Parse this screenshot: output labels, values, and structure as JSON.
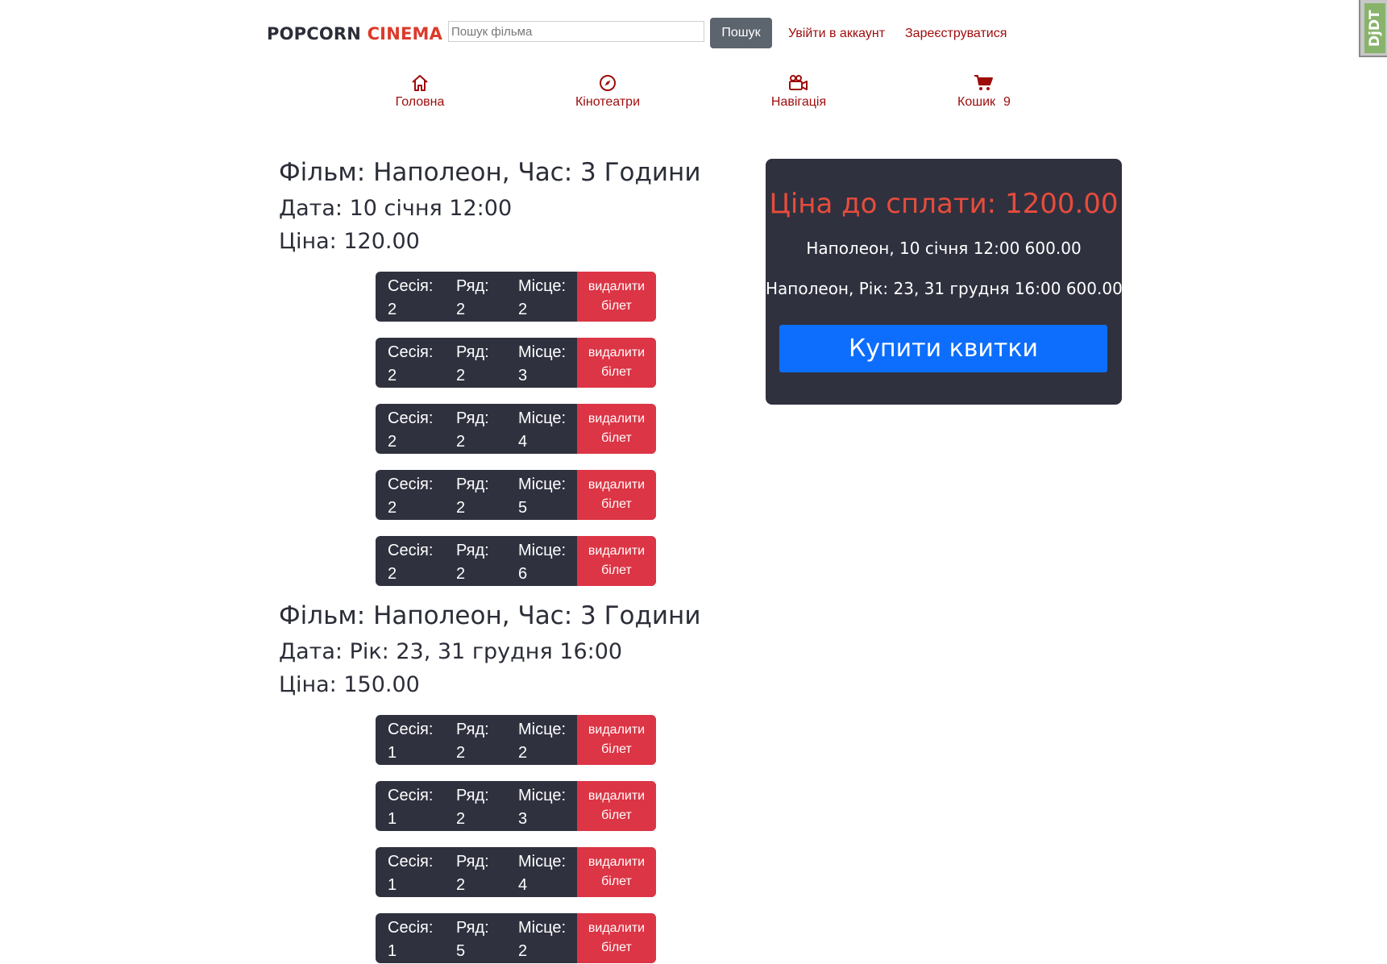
{
  "header": {
    "logo_part1": "POPCORN",
    "logo_part2": "CINEMA",
    "search_placeholder": "Пошук фільма",
    "search_button": "Пошук",
    "login": "Увійти в аккаунт",
    "register": "Зареєструватися"
  },
  "nav": {
    "home": {
      "label": "Головна",
      "icon": "home-icon"
    },
    "cinemas": {
      "label": "Кінотеатри",
      "icon": "compass-icon"
    },
    "navigation": {
      "label": "Навігація",
      "icon": "video-camera-icon"
    },
    "cart": {
      "label": "Кошик",
      "count": "9",
      "icon": "cart-icon"
    }
  },
  "labels": {
    "session": "Сесія:",
    "row": "Ряд:",
    "seat": "Місце:",
    "remove": "видалити білет"
  },
  "groups": [
    {
      "film": "Фільм: Наполеон, Час: 3 Години",
      "date": "Дата: 10 січня 12:00",
      "price": "Ціна: 120.00",
      "tickets": [
        {
          "session": "2",
          "row": "2",
          "seat": "2"
        },
        {
          "session": "2",
          "row": "2",
          "seat": "3"
        },
        {
          "session": "2",
          "row": "2",
          "seat": "4"
        },
        {
          "session": "2",
          "row": "2",
          "seat": "5"
        },
        {
          "session": "2",
          "row": "2",
          "seat": "6"
        }
      ]
    },
    {
      "film": "Фільм: Наполеон, Час: 3 Години",
      "date": "Дата: Рік: 23, 31 грудня 16:00",
      "price": "Ціна: 150.00",
      "tickets": [
        {
          "session": "1",
          "row": "2",
          "seat": "2"
        },
        {
          "session": "1",
          "row": "2",
          "seat": "3"
        },
        {
          "session": "1",
          "row": "2",
          "seat": "4"
        },
        {
          "session": "1",
          "row": "5",
          "seat": "2"
        }
      ]
    }
  ],
  "summary": {
    "title": "Ціна до сплати: 1200.00",
    "lines": [
      "Наполеон, 10 січня 12:00 600.00",
      "Наполеон, Рік: 23, 31 грудня 16:00 600.00"
    ],
    "buy_button": "Купити квитки"
  },
  "badge": "DjDT",
  "colors": {
    "accent_red": "#dc3a2b",
    "link_red": "#9e0b0b",
    "dark_panel": "#2f313f",
    "remove_red": "#dc3545",
    "buy_blue": "#0d6efd"
  }
}
